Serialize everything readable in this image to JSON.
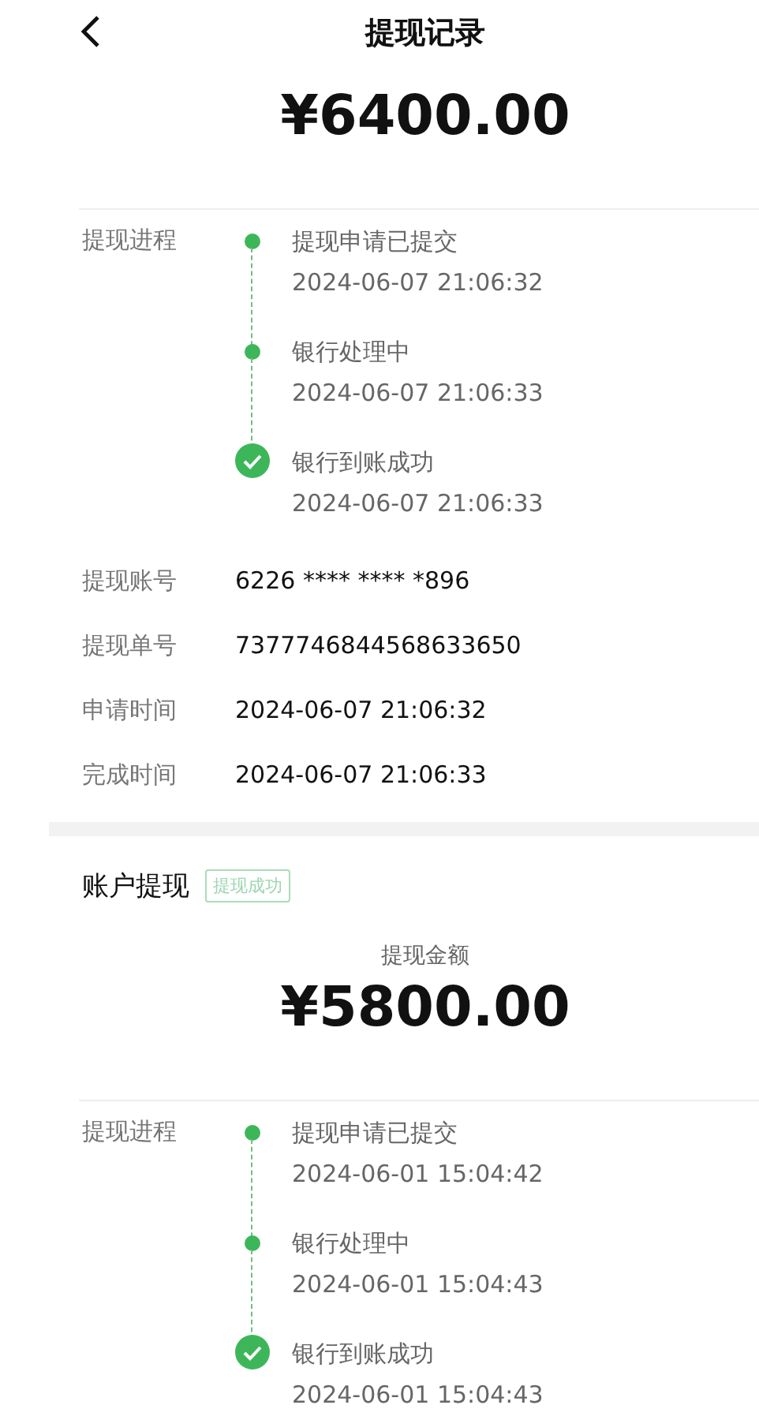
{
  "header": {
    "title": "提现记录"
  },
  "records": [
    {
      "amount": "¥6400.00",
      "progress_label": "提现进程",
      "steps": [
        {
          "kind": "dot",
          "title": "提现申请已提交",
          "time": "2024-06-07 21:06:32"
        },
        {
          "kind": "dot",
          "title": "银行处理中",
          "time": "2024-06-07 21:06:33"
        },
        {
          "kind": "check",
          "title": "银行到账成功",
          "time": "2024-06-07 21:06:33"
        }
      ],
      "details": [
        {
          "label": "提现账号",
          "value": "6226 **** **** *896"
        },
        {
          "label": "提现单号",
          "value": "7377746844568633650"
        },
        {
          "label": "申请时间",
          "value": "2024-06-07 21:06:32"
        },
        {
          "label": "完成时间",
          "value": "2024-06-07 21:06:33"
        }
      ]
    },
    {
      "section_title": "账户提现",
      "tag": "提现成功",
      "amount_label": "提现金额",
      "amount": "¥5800.00",
      "progress_label": "提现进程",
      "steps": [
        {
          "kind": "dot",
          "title": "提现申请已提交",
          "time": "2024-06-01 15:04:42"
        },
        {
          "kind": "dot",
          "title": "银行处理中",
          "time": "2024-06-01 15:04:43"
        },
        {
          "kind": "check",
          "title": "银行到账成功",
          "time": "2024-06-01 15:04:43"
        }
      ]
    }
  ]
}
